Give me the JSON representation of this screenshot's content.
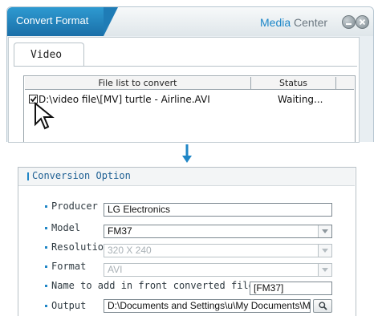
{
  "window": {
    "title": "Convert Format",
    "brand_media": "Media",
    "brand_center": " Center"
  },
  "tabs": {
    "video": "Video"
  },
  "file_list": {
    "columns": [
      "File list to convert",
      "Status"
    ],
    "rows": [
      {
        "checked": true,
        "path": "D:\\video file\\[MV] turtle - Airline.AVI",
        "status": "Waiting..."
      }
    ]
  },
  "conversion": {
    "title": "Conversion Option",
    "producer": {
      "label": "Producer",
      "value": "LG Electronics"
    },
    "model": {
      "label": "Model",
      "value": "FM37"
    },
    "resolution": {
      "label": "Resolution",
      "value": "320 X 240"
    },
    "format": {
      "label": "Format",
      "value": "AVI"
    },
    "name_prefix": {
      "label": "Name to add in front converted file name",
      "value": "[FM37]"
    },
    "output": {
      "label": "Output",
      "value": "D:\\Documents and Settings\\u\\My Documents\\M"
    }
  },
  "colors": {
    "accent": "#1f86c6",
    "title_tab": "#1a6fa8"
  }
}
